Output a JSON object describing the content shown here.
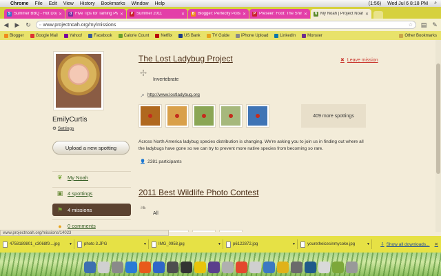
{
  "menubar": {
    "app": "Chrome",
    "items": [
      "File",
      "Edit",
      "View",
      "History",
      "Bookmarks",
      "Window",
      "Help"
    ],
    "status": "(1:56)",
    "clock": "Wed Jul 6  8:18 PM"
  },
  "tabs": [
    {
      "label": "Summer BBQ - Hot Dog S",
      "icon_letter": "S",
      "icon_color": "#3a6fc9"
    },
    {
      "label": "Five Tips for Taming PMS",
      "icon_letter": "d",
      "icon_color": "#7a2da0"
    },
    {
      "label": "Summer 2011",
      "icon_letter": "P",
      "icon_color": "#c8232c"
    },
    {
      "label": "Blogger: Perfectly Polishe",
      "icon_letter": "B",
      "icon_color": "#f08a1c"
    },
    {
      "label": "Preseer: Foot: The Shirt Dr",
      "icon_letter": "P",
      "icon_color": "#c8232c"
    },
    {
      "label": "My Noah | Project Noah",
      "icon_letter": "N",
      "icon_color": "#5c8a2b",
      "active": true
    }
  ],
  "address": {
    "url": "www.projectnoah.org/my/missions"
  },
  "bookmarks": [
    {
      "label": "Blogger",
      "color": "#f08a1c"
    },
    {
      "label": "Google Mail",
      "color": "#d33"
    },
    {
      "label": "Yahoo!",
      "color": "#7b0099"
    },
    {
      "label": "Facebook",
      "color": "#3b5998"
    },
    {
      "label": "Calorie Count",
      "color": "#6a9e2f"
    },
    {
      "label": "Netflix",
      "color": "#b9090b"
    },
    {
      "label": "US Bank",
      "color": "#1f3c88"
    },
    {
      "label": "TV Guide",
      "color": "#e8a31c"
    },
    {
      "label": "iPhone Upload",
      "color": "#888"
    },
    {
      "label": "LinkedIn",
      "color": "#0e76a8"
    },
    {
      "label": "Monster",
      "color": "#6e2c8e"
    }
  ],
  "bookmarks_other": "Other Bookmarks",
  "profile": {
    "name": "EmilyCurtis",
    "settings": "Settings",
    "upload_button": "Upload a new spotting"
  },
  "sidebar": [
    {
      "label": "My Noah",
      "icon": "leaf-icon",
      "glyph": "❦",
      "color": "#7aa83a"
    },
    {
      "label": "4 spottings",
      "icon": "camera-icon",
      "glyph": "▣",
      "color": "#6a8c3a"
    },
    {
      "label": "4 missions",
      "icon": "flag-icon",
      "glyph": "⚑",
      "color": "#7aa83a",
      "active": true
    },
    {
      "label": "0 comments",
      "icon": "comment-icon",
      "glyph": "●",
      "color": "#e8a31c"
    }
  ],
  "mission1": {
    "title": "The Lost Ladybug Project",
    "leave": "Leave mission",
    "category": "Invertebrate",
    "link": "http://www.lostladybug.org",
    "more": "409 more spottings",
    "description": "Across North America ladybug species distribution is changing. We're asking you to join us in finding out where all the ladybugs have gone so we can try to prevent more native species from becoming so rare.",
    "participants": "2381 participants",
    "thumbs": [
      "#b0681e",
      "#d9a04a",
      "#8ba655",
      "#a6b87c",
      "#3f74b5"
    ]
  },
  "mission2": {
    "title": "2011 Best Wildlife Photo Contest",
    "category": "All",
    "thumbs": [
      "#7a8f4a",
      "#5c7a36",
      "#9aa66a",
      "#6e8c4c"
    ]
  },
  "statusbar": "www.projectnoah.org/missions/14023",
  "downloads": [
    "4758189801_c3068f9....jpg",
    "photo 3.JPG",
    "IMG_0958.jpg",
    "p6122872.jpg",
    "youretheicesinmycoke.jpg"
  ],
  "show_all_downloads": "Show all downloads...",
  "dock": [
    "#3d6fb0",
    "#d0d0d0",
    "#8a8a8a",
    "#2a7bd6",
    "#e85a1b",
    "#2f66c8",
    "#4e4e4e",
    "#333",
    "#e8c40a",
    "#5a3f8c",
    "#b0b0b0",
    "#e4482d",
    "#cfcfcf",
    "#3c79c2",
    "#e0b21a",
    "#6b6b6b",
    "#1f5a8a",
    "#d9d9d9",
    "#7da83a",
    "#999"
  ]
}
